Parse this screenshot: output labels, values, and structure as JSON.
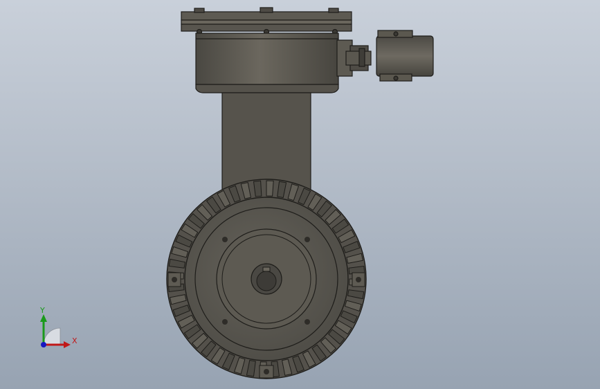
{
  "viewport": {
    "background_top": "#c9d0da",
    "background_bottom": "#97a3b2",
    "model_color": "#5a5750",
    "edge_color": "#1e1d1a"
  },
  "triad": {
    "x_label": "X",
    "y_label": "Y",
    "x_color": "#c01818",
    "y_color": "#1a9a1a",
    "z_color": "#1818c0"
  }
}
